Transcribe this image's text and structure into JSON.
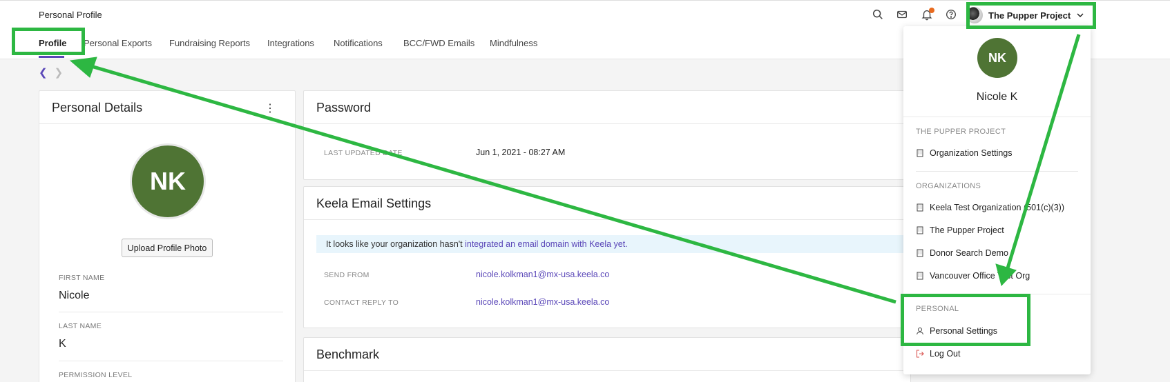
{
  "header": {
    "title": "Personal Profile",
    "org_name": "The Pupper Project",
    "icons": [
      "search-icon",
      "mail-icon",
      "bell-icon",
      "help-icon"
    ]
  },
  "tabs": [
    {
      "label": "Profile",
      "active": true
    },
    {
      "label": "Personal Exports"
    },
    {
      "label": "Fundraising Reports"
    },
    {
      "label": "Integrations"
    },
    {
      "label": "Notifications"
    },
    {
      "label": "BCC/FWD Emails"
    },
    {
      "label": "Mindfulness"
    }
  ],
  "personal_details": {
    "title": "Personal Details",
    "initials": "NK",
    "upload_label": "Upload Profile Photo",
    "first_name_label": "FIRST NAME",
    "first_name": "Nicole",
    "last_name_label": "LAST NAME",
    "last_name": "K",
    "permission_label": "PERMISSION LEVEL"
  },
  "password": {
    "title": "Password",
    "last_updated_label": "LAST UPDATED DATE",
    "last_updated_value": "Jun 1, 2021 - 08:27 AM"
  },
  "email_settings": {
    "title": "Keela Email Settings",
    "info_text": "It looks like your organization hasn't ",
    "info_link": "integrated an email domain with Keela yet.",
    "send_from_label": "SEND FROM",
    "send_from_value": "nicole.kolkman1@mx-usa.keela.co",
    "reply_to_label": "CONTACT REPLY TO",
    "reply_to_value": "nicole.kolkman1@mx-usa.keela.co"
  },
  "benchmark": {
    "title": "Benchmark"
  },
  "dropdown": {
    "initials": "NK",
    "name": "Nicole K",
    "current_org_section": "THE PUPPER PROJECT",
    "org_settings": "Organization Settings",
    "orgs_section": "ORGANIZATIONS",
    "orgs": [
      "Keela Test Organization (501(c)(3))",
      "The Pupper Project",
      "Donor Search Demo",
      "Vancouver Office Test Org"
    ],
    "personal_section": "PERSONAL",
    "personal_settings": "Personal Settings",
    "logout": "Log Out"
  },
  "colors": {
    "accent": "#5a47b8",
    "avatar": "#4f7434",
    "highlight": "#2db742",
    "notif": "#e86a1e"
  }
}
